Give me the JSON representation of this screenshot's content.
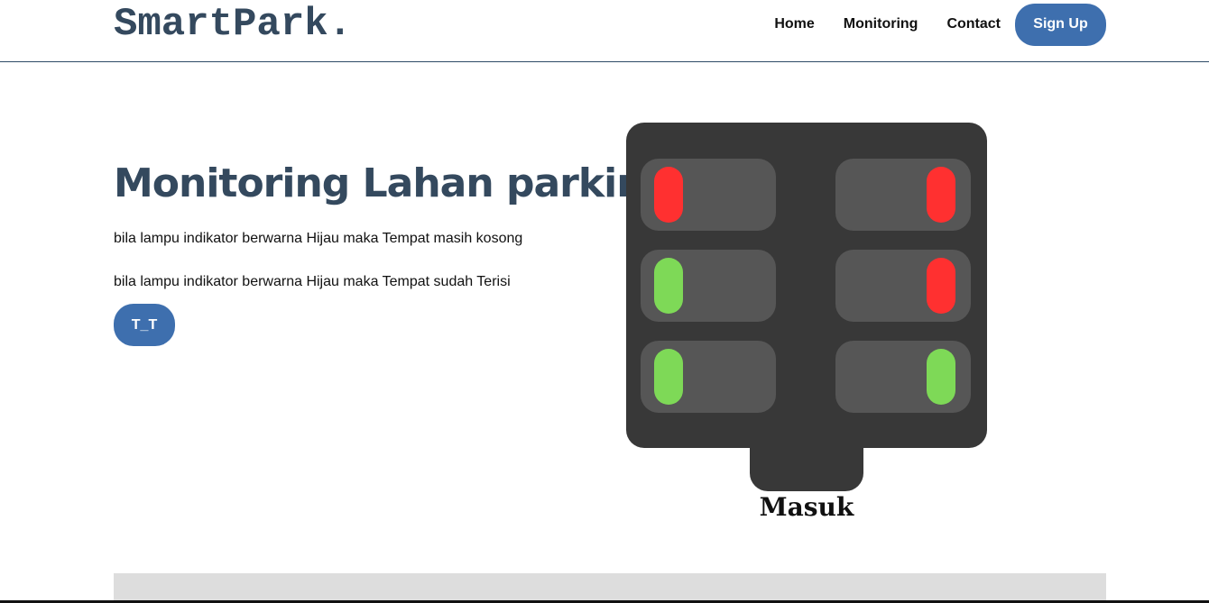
{
  "brand": {
    "logo": "SmartPark."
  },
  "nav": {
    "links": [
      "Home",
      "Monitoring",
      "Contact"
    ],
    "signup": "Sign Up"
  },
  "hero": {
    "title": "Monitoring Lahan parkir",
    "desc1": "bila lampu indikator berwarna Hijau maka Tempat masih kosong",
    "desc2": "bila lampu indikator berwarna Hijau maka Tempat sudah Terisi",
    "button": "T_T"
  },
  "colors": {
    "accent": "#3e6fae",
    "title": "#34495e",
    "occupied": "#ff3030",
    "empty": "#7ed957"
  },
  "parking": {
    "gate_label": "Masuk",
    "slots": [
      {
        "status": "occupied"
      },
      {
        "status": "occupied"
      },
      {
        "status": "empty"
      },
      {
        "status": "occupied"
      },
      {
        "status": "empty"
      },
      {
        "status": "empty"
      }
    ]
  }
}
